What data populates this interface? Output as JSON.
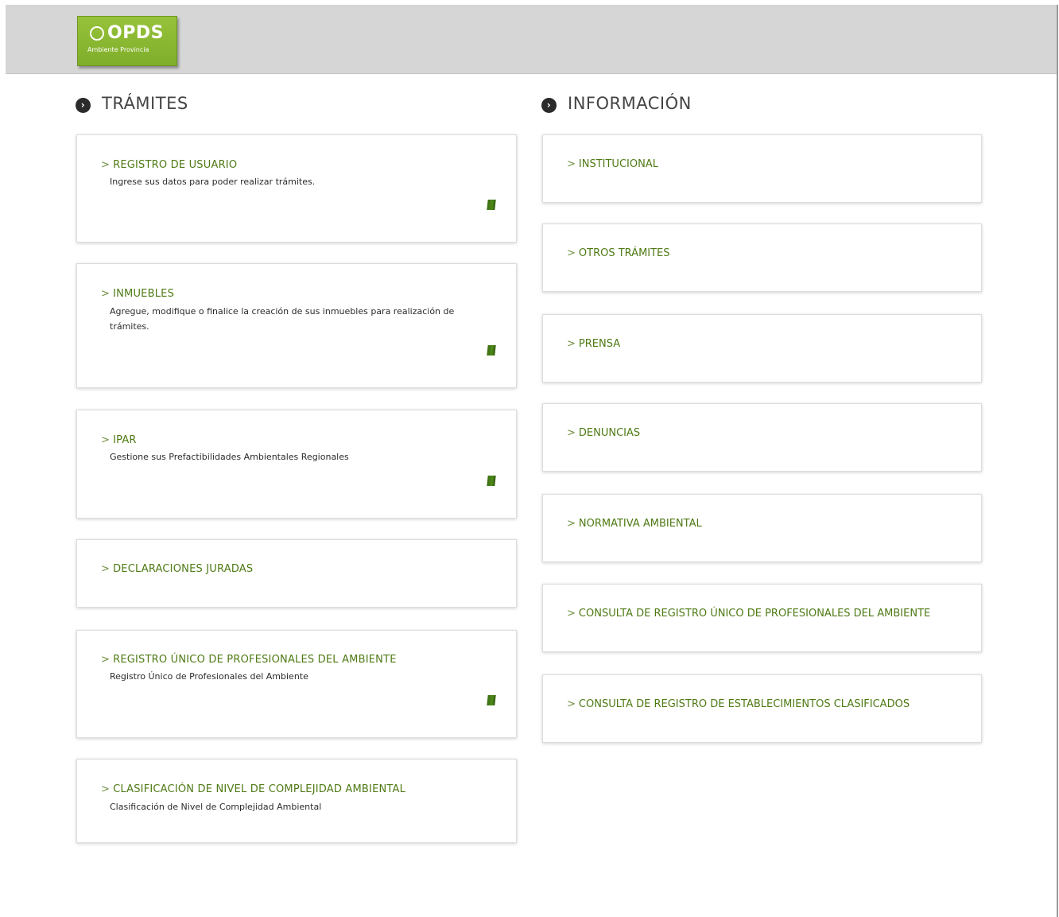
{
  "header": {
    "logo_text": "OPDS",
    "logo_sub": "Ambiente Provincia"
  },
  "tramites": {
    "title": "TRÁMITES",
    "arrow": ">",
    "items": [
      {
        "label": "REGISTRO DE USUARIO",
        "description": "Ingrese sus datos para poder realizar trámites."
      },
      {
        "label": "INMUEBLES",
        "description": "Agregue, modifique o finalice la creación de sus inmuebles para realización de trámites."
      },
      {
        "label": "IPAR",
        "description": "Gestione sus Prefactibilidades Ambientales Regionales"
      },
      {
        "label": "DECLARACIONES JURADAS",
        "description": ""
      },
      {
        "label": "REGISTRO ÚNICO DE PROFESIONALES DEL AMBIENTE",
        "description": "Registro Único de Profesionales del Ambiente"
      },
      {
        "label": "CLASIFICACIÓN DE NIVEL DE COMPLEJIDAD AMBIENTAL",
        "description": "Clasificación de Nivel de Complejidad Ambiental"
      }
    ]
  },
  "informacion": {
    "title": "INFORMACIÓN",
    "arrow": ">",
    "items": [
      {
        "label": "INSTITUCIONAL"
      },
      {
        "label": "OTROS TRÁMITES"
      },
      {
        "label": "PRENSA"
      },
      {
        "label": "DENUNCIAS"
      },
      {
        "label": "NORMATIVA AMBIENTAL"
      },
      {
        "label": "CONSULTA DE REGISTRO ÚNICO DE PROFESIONALES DEL AMBIENTE"
      },
      {
        "label": "CONSULTA DE REGISTRO DE ESTABLECIMIENTOS CLASIFICADOS"
      }
    ]
  },
  "colors": {
    "accent_green": "#8bbb33",
    "link_green": "#4e7a14",
    "header_gray": "#d6d6d6"
  },
  "icons": {
    "section": "circle-chevron-right-icon",
    "card_action": "green-card-icon"
  }
}
